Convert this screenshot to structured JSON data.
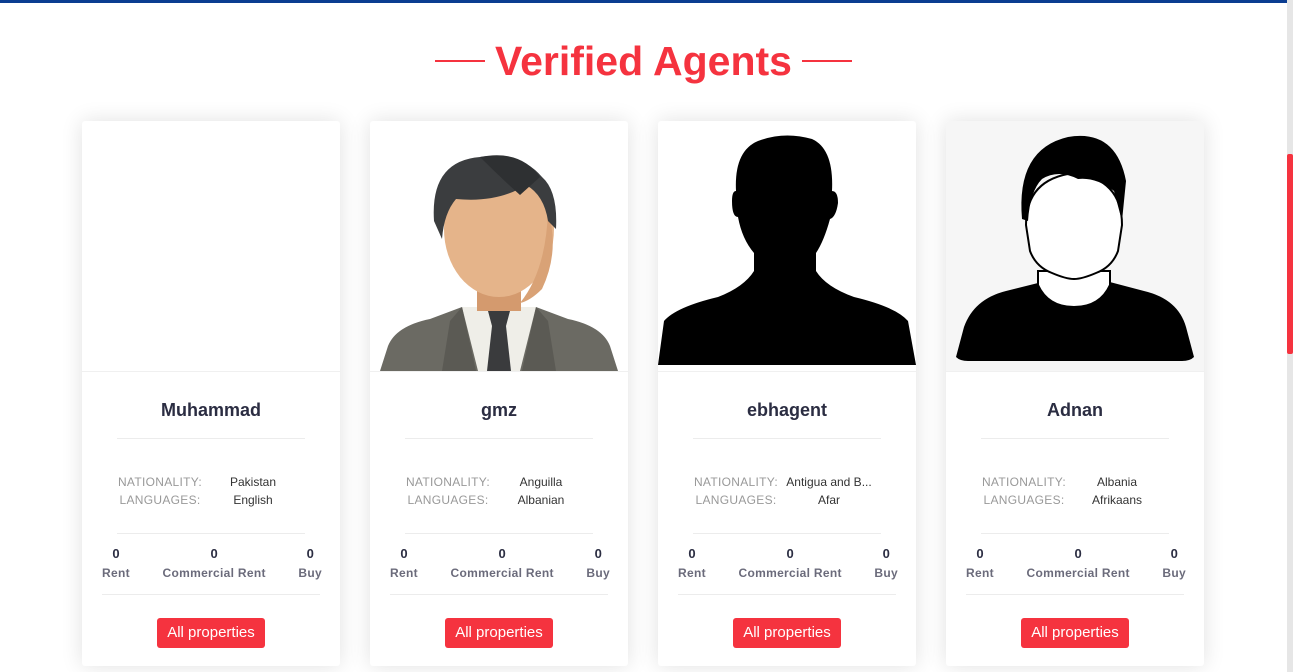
{
  "section": {
    "title": "Verified Agents"
  },
  "labels": {
    "nationality": "NATIONALITY:",
    "languages": "LANGUAGES:",
    "rent": "Rent",
    "commercial_rent": "Commercial Rent",
    "buy": "Buy",
    "all_properties": "All properties"
  },
  "agents": [
    {
      "name": "Muhammad",
      "nationality": "Pakistan",
      "languages": "English",
      "rent": "0",
      "commercial_rent": "0",
      "buy": "0",
      "avatar": "none"
    },
    {
      "name": "gmz",
      "nationality": "Anguilla",
      "languages": "Albanian",
      "rent": "0",
      "commercial_rent": "0",
      "buy": "0",
      "avatar": "businessman-avatar"
    },
    {
      "name": "ebhagent",
      "nationality": "Antigua and B...",
      "languages": "Afar",
      "rent": "0",
      "commercial_rent": "0",
      "buy": "0",
      "avatar": "silhouette-avatar"
    },
    {
      "name": "Adnan",
      "nationality": "Albania",
      "languages": "Afrikaans",
      "rent": "0",
      "commercial_rent": "0",
      "buy": "0",
      "avatar": "outline-avatar"
    }
  ],
  "colors": {
    "accent": "#f5333f",
    "topbar": "#0b3d91",
    "name_text": "#2b2d42"
  }
}
